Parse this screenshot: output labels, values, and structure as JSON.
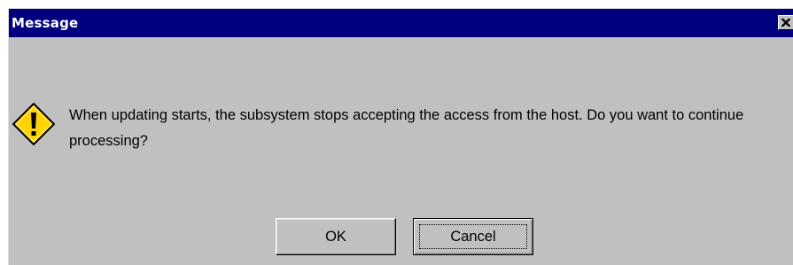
{
  "window": {
    "title": "Message",
    "close_glyph": "close-icon"
  },
  "dialog": {
    "icon": "warning-icon",
    "message": "When updating starts, the subsystem stops accepting the access from the host. Do you want to continue processing?",
    "ok_label": "OK",
    "cancel_label": "Cancel",
    "focused_button": "Cancel"
  },
  "colors": {
    "titlebar": "#00007f",
    "window_bg": "#c0c0c0",
    "icon_fill": "#ffd400"
  }
}
